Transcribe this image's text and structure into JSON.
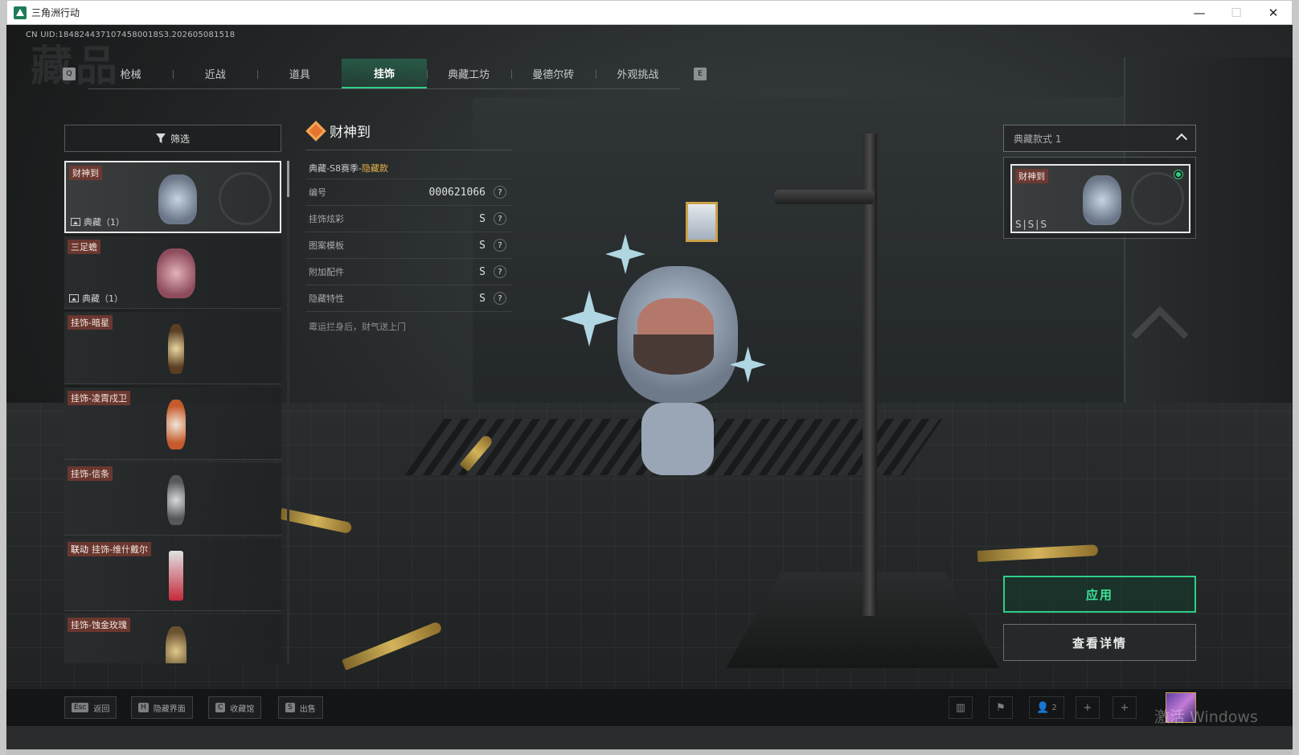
{
  "window": {
    "title": "三角洲行动",
    "minimize": "—",
    "maximize": "☐",
    "close": "✕"
  },
  "uid": "CN UID:1848244371074580018S3.202605081518",
  "background_title": "藏品",
  "tabs": {
    "prev_key": "Q",
    "next_key": "E",
    "items": [
      {
        "label": "枪械"
      },
      {
        "label": "近战"
      },
      {
        "label": "道具"
      },
      {
        "label": "挂饰",
        "active": true
      },
      {
        "label": "典藏工坊"
      },
      {
        "label": "曼德尔砖"
      },
      {
        "label": "外观挑战"
      }
    ]
  },
  "filter": {
    "label": "筛选"
  },
  "items": [
    {
      "name": "财神到",
      "count": "典藏（1）",
      "selected": true
    },
    {
      "name": "三足蟾",
      "count": "典藏（1）"
    },
    {
      "name": "挂饰-暗星"
    },
    {
      "name": "挂饰-凌霄戍卫"
    },
    {
      "name": "挂饰-信条"
    },
    {
      "tag": "联动",
      "name": "挂饰-维什戴尔"
    },
    {
      "name": "挂饰-蚀金玫瑰"
    }
  ],
  "detail": {
    "title": "财神到",
    "season_prefix": "典藏-S8赛季-",
    "season_hidden": "隐藏款",
    "rows": [
      {
        "label": "编号",
        "value": "000621066"
      },
      {
        "label": "挂饰炫彩",
        "value": "S"
      },
      {
        "label": "图案模板",
        "value": "S"
      },
      {
        "label": "附加配件",
        "value": "S"
      },
      {
        "label": "隐藏特性",
        "value": "S"
      }
    ],
    "help_mark": "?",
    "description": "霉运拦身后，财气送上门"
  },
  "style_panel": {
    "selector_label": "典藏款式 1",
    "card_name": "财神到",
    "card_grades": "S|S|S"
  },
  "actions": {
    "apply": "应用",
    "details": "查看详情"
  },
  "bottom_hints": [
    {
      "key": "Esc",
      "label": "返回"
    },
    {
      "key": "H",
      "label": "隐藏界面"
    },
    {
      "key": "C",
      "label": "收藏馆"
    },
    {
      "key": "S",
      "label": "出售"
    }
  ],
  "tray": {
    "friends_count": "2",
    "plus": "+"
  },
  "watermark": "激活 Windows",
  "colors": {
    "accent": "#2fcf86",
    "selected_border": "#e8e8e8",
    "item_label_bg": "#763a30",
    "hidden_variant": "#e6b34a"
  }
}
